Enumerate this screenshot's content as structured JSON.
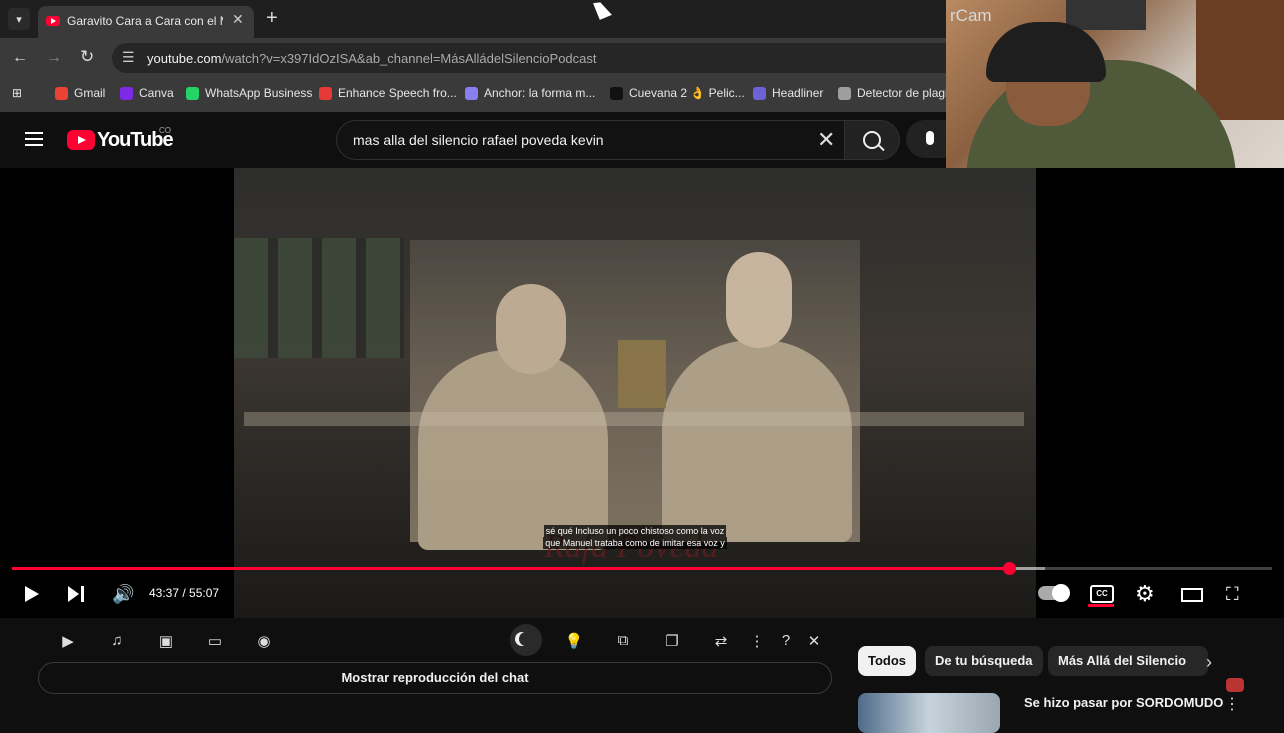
{
  "browser": {
    "tab_title": "Garavito Cara a Cara con el Mo",
    "tab_close": "✕",
    "new_tab": "+",
    "url_host": "youtube.com",
    "url_rest": "/watch?v=x397IdOzISA&ab_channel=MásAlládelSilencioPodcast"
  },
  "bookmarks": [
    {
      "label": "Gmail",
      "color": "#ea4335"
    },
    {
      "label": "Canva",
      "color": "#7d2ae8"
    },
    {
      "label": "WhatsApp Business",
      "color": "#25d366"
    },
    {
      "label": "Enhance Speech fro...",
      "color": "#e53935"
    },
    {
      "label": "Anchor: la forma m...",
      "color": "#8a7ff0"
    },
    {
      "label": "Cuevana 2 👌 Pelic...",
      "color": "#111111"
    },
    {
      "label": "Headliner",
      "color": "#6b63d6"
    },
    {
      "label": "Detector de plagi",
      "color": "#9e9e9e"
    }
  ],
  "youtube": {
    "wordmark": "YouTube",
    "country_code": "CO",
    "search_query": "mas alla del silencio rafael poveda kevin",
    "search_clear": "✕"
  },
  "webcam": {
    "label": "rCam"
  },
  "video": {
    "caption_line1": "sé qué Incluso un poco chistoso como la voz",
    "caption_line2": "que Manuel trataba como de imitar esa voz y",
    "watermark": "Rafa Poveda"
  },
  "player": {
    "time_display": "43:37 / 55:07",
    "progress_fraction": 0.7914,
    "buffer_fraction": 0.8197,
    "volume_icon": "🔊",
    "settings_icon": "⚙",
    "fullscreen_icon": "⛶",
    "subs_icon": "CC"
  },
  "extensions": [
    {
      "name": "camera",
      "glyph": "▶"
    },
    {
      "name": "music",
      "glyph": "♫"
    },
    {
      "name": "image",
      "glyph": "▣"
    },
    {
      "name": "captions",
      "glyph": "▭"
    },
    {
      "name": "screenshot",
      "glyph": "◉"
    },
    {
      "name": "bulb",
      "glyph": "💡"
    },
    {
      "name": "pip",
      "glyph": "⧉"
    },
    {
      "name": "copy",
      "glyph": "❐"
    },
    {
      "name": "loop",
      "glyph": "⇄"
    },
    {
      "name": "more",
      "glyph": "⋮"
    },
    {
      "name": "help",
      "glyph": "?"
    },
    {
      "name": "close",
      "glyph": "✕"
    }
  ],
  "chat_replay": "Mostrar reproducción del chat",
  "chips": [
    "Todos",
    "De tu búsqueda",
    "Más Allá del Silencio"
  ],
  "chips_next": "›",
  "recommendation": {
    "title": "Se hizo pasar por SORDOMUDO",
    "more": "⋮"
  }
}
